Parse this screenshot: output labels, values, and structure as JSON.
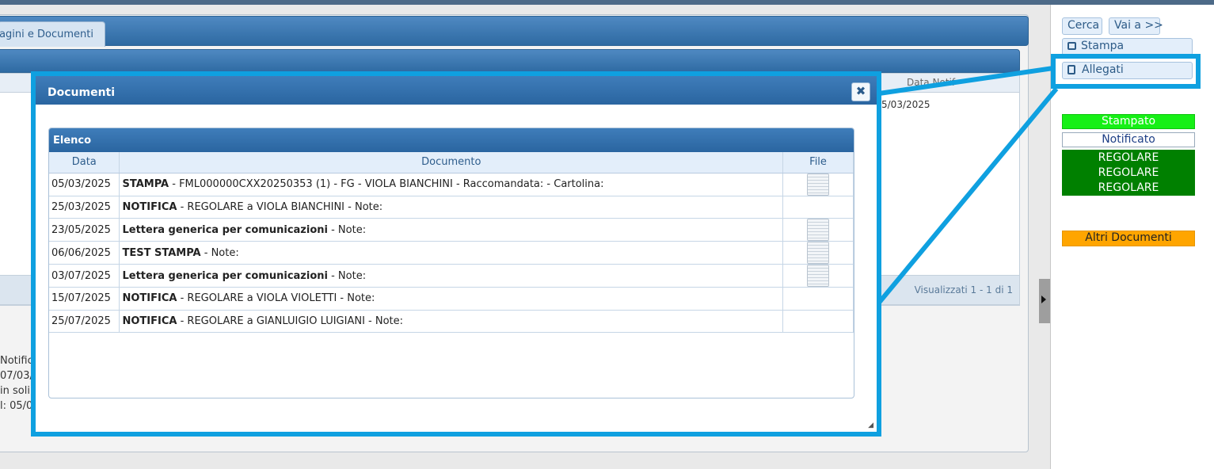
{
  "main": {
    "tab_label": "agini e Documenti",
    "grid_header_label": "Data Notif",
    "grid_row_value": "5/03/2025",
    "footer_text": "Visualizzati 1 - 1 di 1",
    "side_lines": [
      "Notific",
      "07/03/",
      "in soli",
      "l: 05/0"
    ]
  },
  "right_panel": {
    "cerca_label": "Cerca",
    "vai_label": "Vai a >>",
    "stampa_label": "Stampa",
    "allegati_label": "Allegati",
    "status": {
      "stampato": "Stampato",
      "notificato": "Notificato",
      "regolare": [
        "REGOLARE",
        "REGOLARE",
        "REGOLARE"
      ],
      "altri": "Altri Documenti"
    }
  },
  "modal": {
    "title": "Documenti",
    "close_glyph": "✖",
    "panel_title": "Elenco",
    "columns": [
      "Data",
      "Documento",
      "File"
    ],
    "rows": [
      {
        "date": "05/03/2025",
        "bold": "STAMPA",
        "rest": " - FML000000CXX20250353 (1) - FG - VIOLA BIANCHINI - Raccomandata:  - Cartolina:",
        "has_file": true
      },
      {
        "date": "25/03/2025",
        "bold": "NOTIFICA",
        "rest": " - REGOLARE a VIOLA BIANCHINI - Note:",
        "has_file": false
      },
      {
        "date": "23/05/2025",
        "bold": "Lettera generica per comunicazioni",
        "rest": " - Note:",
        "has_file": true
      },
      {
        "date": "06/06/2025",
        "bold": "TEST STAMPA",
        "rest": " - Note:",
        "has_file": true
      },
      {
        "date": "03/07/2025",
        "bold": "Lettera generica per comunicazioni",
        "rest": " - Note:",
        "has_file": true
      },
      {
        "date": "15/07/2025",
        "bold": "NOTIFICA",
        "rest": " - REGOLARE a VIOLA VIOLETTI - Note:",
        "has_file": false
      },
      {
        "date": "25/07/2025",
        "bold": "NOTIFICA",
        "rest": " - REGOLARE a GIANLUIGIO LUIGIANI - Note:",
        "has_file": false
      }
    ]
  },
  "colors": {
    "highlight": "#0fa0e0",
    "header_blue": "#2a65a0",
    "stampato": "#16f016",
    "regolare": "#008000",
    "altri": "#ffa500"
  }
}
